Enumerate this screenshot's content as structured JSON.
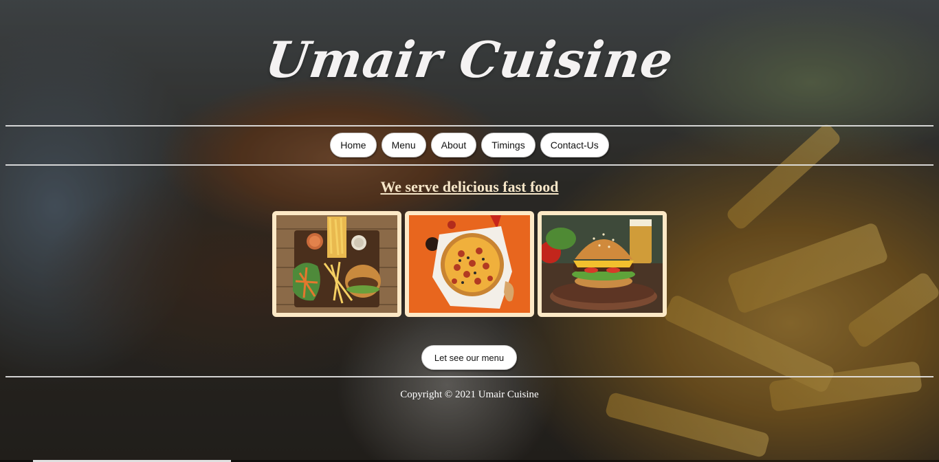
{
  "brand": {
    "title": "Umair Cuisine"
  },
  "nav": {
    "items": [
      {
        "label": "Home"
      },
      {
        "label": "Menu"
      },
      {
        "label": "About"
      },
      {
        "label": "Timings"
      },
      {
        "label": "Contact-Us"
      }
    ]
  },
  "main": {
    "tagline": "We serve delicious fast food",
    "gallery": [
      {
        "name": "burger-fries-board-photo"
      },
      {
        "name": "pizza-photo"
      },
      {
        "name": "burger-photo"
      }
    ],
    "cta_label": "Let see our menu"
  },
  "footer": {
    "copyright": "Copyright © 2021 Umair Cuisine"
  },
  "colors": {
    "tagline": "#f6e6c8",
    "tile_border": "#fde9c6",
    "button_bg": "#ffffff",
    "rule": "#e8e8e8"
  }
}
